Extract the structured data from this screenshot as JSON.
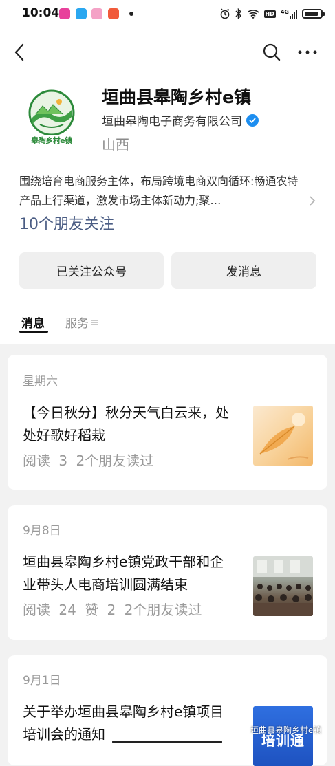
{
  "status_bar": {
    "time": "10:04",
    "network_label": "HD",
    "signal_label": "4G",
    "battery_level": 0.85
  },
  "account": {
    "logo_text": "皋陶乡村e镇",
    "name": "垣曲县皋陶乡村e镇",
    "company": "垣曲皋陶电子商务有限公司",
    "region": "山西",
    "description": "围绕培育电商服务主体，布局跨境电商双向循环:畅通农特产品上行渠道，激发市场主体新动力;聚…",
    "friends_following": "10个朋友关注"
  },
  "actions": {
    "follow_label": "已关注公众号",
    "message_label": "发消息"
  },
  "tabs": {
    "messages": "消息",
    "services": "服务"
  },
  "articles": [
    {
      "date": "星期六",
      "title": "【今日秋分】秋分天气白云来，处处好歌好稻栽",
      "meta": "阅读 3 2个朋友读过"
    },
    {
      "date": "9月8日",
      "title": "垣曲县皋陶乡村e镇党政干部和企业带头人电商培训圆满结束",
      "meta": "阅读 24 赞 2 2个朋友读过"
    },
    {
      "date": "9月1日",
      "title": "关于举办垣曲县皋陶乡村e镇项目培训会的通知",
      "thumb_text": "培训通"
    }
  ],
  "watermark": "垣曲县皋陶乡村e镇",
  "colors": {
    "link": "#4b5d84",
    "verified": "#1d8ef0",
    "logo_green": "#2c8a3a"
  }
}
